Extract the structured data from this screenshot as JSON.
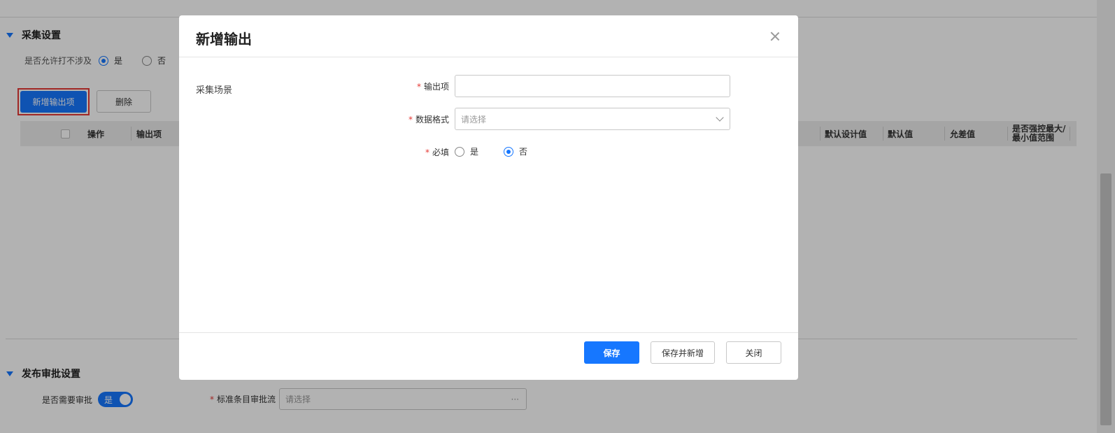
{
  "background": {
    "collect_section": {
      "title": "采集设置",
      "allow_label": "是否允许打不涉及",
      "option_yes": "是",
      "option_no": "否",
      "selected": "是"
    },
    "toolbar": {
      "add_label": "新增输出项",
      "delete_label": "删除"
    },
    "table": {
      "columns": [
        "操作",
        "输出项",
        "默认设计值",
        "默认值",
        "允差值",
        "是否强控最大/最小值范围"
      ],
      "col_last_line1": "是否强控最大/",
      "col_last_line2": "最小值范围"
    },
    "publish_section": {
      "title": "发布审批设置",
      "need_approval_label": "是否需要审批",
      "toggle_text": "是",
      "toggle_on": true,
      "flow_label": "标准条目审批流",
      "flow_placeholder": "请选择",
      "flow_ellipsis": "···"
    }
  },
  "modal": {
    "title": "新增输出",
    "scene_label": "采集场景",
    "fields": {
      "output_item_label": "输出项",
      "output_item_value": "",
      "data_format_label": "数据格式",
      "data_format_placeholder": "请选择",
      "required_label": "必填",
      "required_yes": "是",
      "required_no": "否",
      "required_selected": "否"
    },
    "required_mark": "*",
    "footer": {
      "save_label": "保存",
      "save_new_label": "保存并新增",
      "close_label": "关闭"
    }
  },
  "colors": {
    "primary": "#1677ff",
    "required": "#e53935",
    "highlight_border": "#e53935"
  },
  "icons": {
    "section_toggle": "caret-down-icon",
    "modal_close": "close-icon",
    "select": "chevron-down-icon"
  }
}
